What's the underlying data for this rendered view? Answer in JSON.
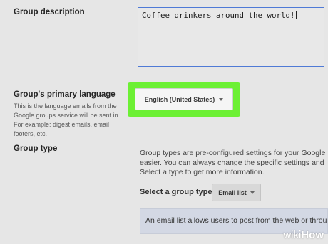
{
  "group_description": {
    "label": "Group description",
    "value": "Coffee drinkers around the world!"
  },
  "primary_language": {
    "label": "Group's primary language",
    "help": "This is the language emails from the Google groups service will be sent in. For example: digest emails, email footers, etc.",
    "selected": "English (United States)"
  },
  "group_type": {
    "label": "Group type",
    "description_lines": [
      "Group types are pre-configured settings for your Google",
      "easier. You can always change the specific settings and",
      "Select a type to get more information."
    ],
    "select_label": "Select a group type",
    "selected": "Email list",
    "info": "An email list allows users to post from the web or through"
  },
  "highlight_color": "#6cf034",
  "watermark": {
    "prefix": "wiki",
    "suffix": "How"
  }
}
